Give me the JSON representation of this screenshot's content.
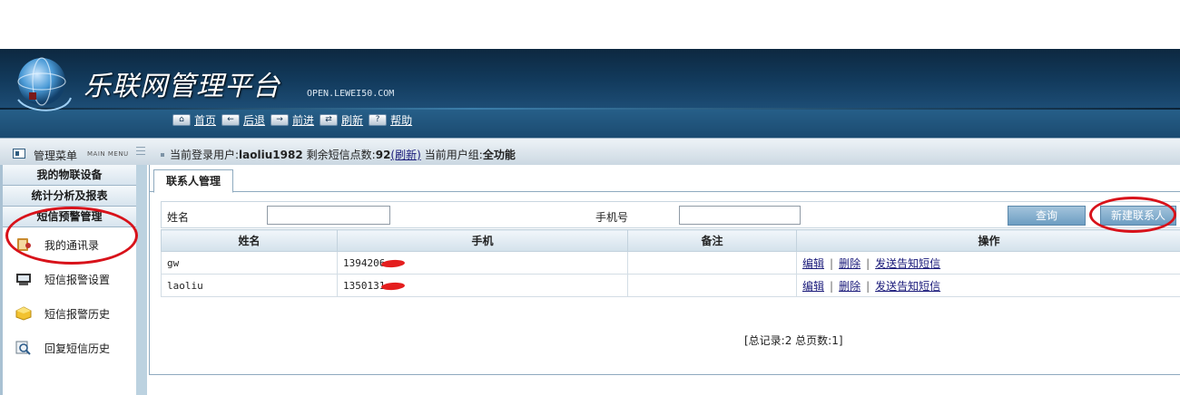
{
  "header": {
    "logo_title": "乐联网管理平台",
    "logo_url": "OPEN.LEWEI50.COM",
    "nav": [
      {
        "icon": "home-icon",
        "glyph": "⌂",
        "label": "首页"
      },
      {
        "icon": "back-icon",
        "glyph": "←",
        "label": "后退"
      },
      {
        "icon": "forward-icon",
        "glyph": "→",
        "label": "前进"
      },
      {
        "icon": "refresh-icon",
        "glyph": "⇄",
        "label": "刷新"
      },
      {
        "icon": "help-icon",
        "glyph": "?",
        "label": "帮助"
      }
    ]
  },
  "sidebar": {
    "title": "管理菜单",
    "title_en": "MAIN MENU",
    "categories": [
      "我的物联设备",
      "统计分析及报表",
      "短信预警管理"
    ],
    "items": [
      {
        "icon": "contacts-book-icon",
        "label": "我的通讯录"
      },
      {
        "icon": "sms-settings-icon",
        "label": "短信报警设置"
      },
      {
        "icon": "alert-history-icon",
        "label": "短信报警历史"
      },
      {
        "icon": "search-reply-icon",
        "label": "回复短信历史"
      }
    ]
  },
  "status": {
    "login_prefix": "当前登录用户:",
    "username": "laoliu1982",
    "sms_prefix": "剩余短信点数:",
    "sms_count": "92",
    "refresh_link": "(刷新)",
    "group_prefix": "当前用户组:",
    "group": "全功能"
  },
  "main": {
    "tab_label": "联系人管理",
    "search": {
      "name_label": "姓名",
      "phone_label": "手机号",
      "name_value": "",
      "phone_value": "",
      "query_button": "查询",
      "new_button": "新建联系人"
    },
    "table": {
      "columns": [
        "姓名",
        "手机",
        "备注",
        "操作"
      ],
      "rows": [
        {
          "name": "gw",
          "phone": "1394206",
          "note": ""
        },
        {
          "name": "laoliu",
          "phone": "1350131",
          "note": ""
        }
      ],
      "actions": {
        "edit": "编辑",
        "delete": "删除",
        "notify": "发送告知短信",
        "sep": "|"
      }
    },
    "pager": "[总记录:2 总页数:1]"
  },
  "colors": {
    "header_dark": "#0d2840",
    "panel_bg": "#bcd2e0",
    "button_blue": "#6d9dc2",
    "annotation_red": "#d8121a"
  }
}
